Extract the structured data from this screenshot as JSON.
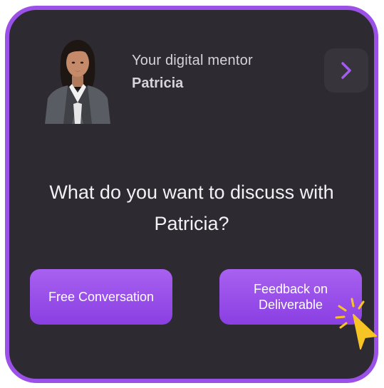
{
  "mentor": {
    "subtitle": "Your digital mentor",
    "name": "Patricia"
  },
  "icons": {
    "next": "chevron-right-icon",
    "cursor": "cursor-pointer-icon",
    "avatar": "mentor-avatar"
  },
  "prompt": {
    "line1": "What do you want to discuss with",
    "line2": "Patricia?"
  },
  "options": {
    "free_label": "Free Conversation",
    "feedback_line1": "Feedback on",
    "feedback_line2": "Deliverable"
  },
  "colors": {
    "accent": "#9b51e8",
    "card_background": "#2e2a31",
    "cursor": "#f7c425"
  }
}
